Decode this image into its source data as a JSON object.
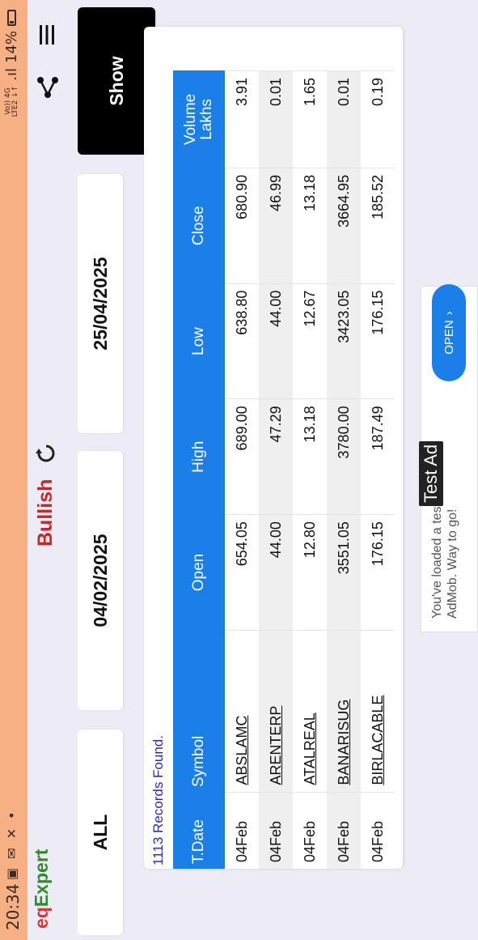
{
  "status_bar": {
    "time": "20:34",
    "network_top": "Vo)) 4G",
    "network_bottom": "LTE2 ↓↑",
    "battery": "14%"
  },
  "header": {
    "logo_eq": "eq",
    "logo_expert": "Expert",
    "mode_title": "Bullish"
  },
  "filters": {
    "segment": "ALL",
    "from_date": "04/02/2025",
    "to_date": "25/04/2025",
    "show_label": "Show"
  },
  "results": {
    "records_found": "1113 Records Found.",
    "columns": [
      "T.Date",
      "Symbol",
      "Open",
      "High",
      "Low",
      "Close",
      "Volume Lakhs"
    ],
    "rows": [
      {
        "date": "04Feb",
        "symbol": "ABSLAMC",
        "open": "654.05",
        "high": "689.00",
        "low": "638.80",
        "close": "680.90",
        "volume": "3.91"
      },
      {
        "date": "04Feb",
        "symbol": "ARENTERP",
        "open": "44.00",
        "high": "47.29",
        "low": "44.00",
        "close": "46.99",
        "volume": "0.01"
      },
      {
        "date": "04Feb",
        "symbol": "ATALREAL",
        "open": "12.80",
        "high": "13.18",
        "low": "12.67",
        "close": "13.18",
        "volume": "1.65"
      },
      {
        "date": "04Feb",
        "symbol": "BANARISUG",
        "open": "3551.05",
        "high": "3780.00",
        "low": "3423.05",
        "close": "3664.95",
        "volume": "0.01"
      },
      {
        "date": "04Feb",
        "symbol": "BIRLACABLE",
        "open": "176.15",
        "high": "187.49",
        "low": "176.15",
        "close": "185.52",
        "volume": "0.19"
      }
    ]
  },
  "ad": {
    "badge": "Test Ad",
    "text": "You've loaded a test ad from AdMob. Way to go!",
    "open_label": "OPEN"
  },
  "colors": {
    "accent_blue": "#1a7fe8",
    "title_red": "#c62828",
    "status_bar": "#f7b084"
  }
}
